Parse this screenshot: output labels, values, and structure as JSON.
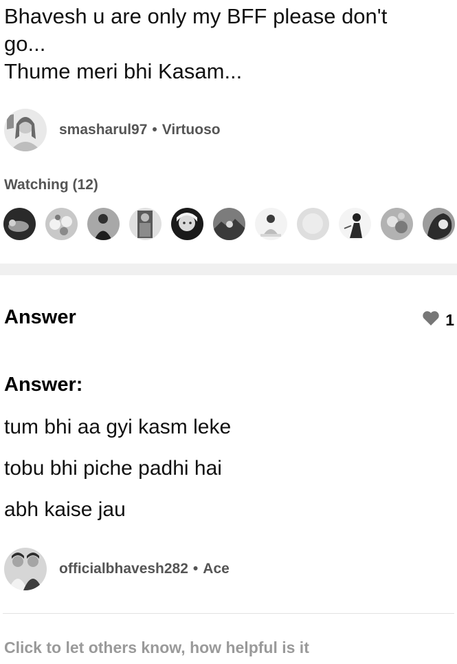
{
  "question": {
    "text": "Bhavesh u are only my BFF please don't\ngo...\nThume meri bhi Kasam..."
  },
  "asker": {
    "username": "smasharul97",
    "separator": "•",
    "rank": "Virtuoso"
  },
  "watching": {
    "label": "Watching (12)"
  },
  "answer_section": {
    "heading": "Answer",
    "like_count": "1",
    "label": "Answer:",
    "lines": [
      "tum bhi aa gyi kasm leke",
      "tobu bhi piche padhi hai",
      "abh kaise jau"
    ]
  },
  "answerer": {
    "username": "officialbhavesh282",
    "separator": "•",
    "rank": "Ace"
  },
  "feedback": {
    "prompt": "Click to let others know, how helpful is it"
  },
  "colors": {
    "meta_text": "#555555",
    "muted_text": "#9a9a9a",
    "separator_bg": "#f0f0f0",
    "heart": "#777777"
  }
}
